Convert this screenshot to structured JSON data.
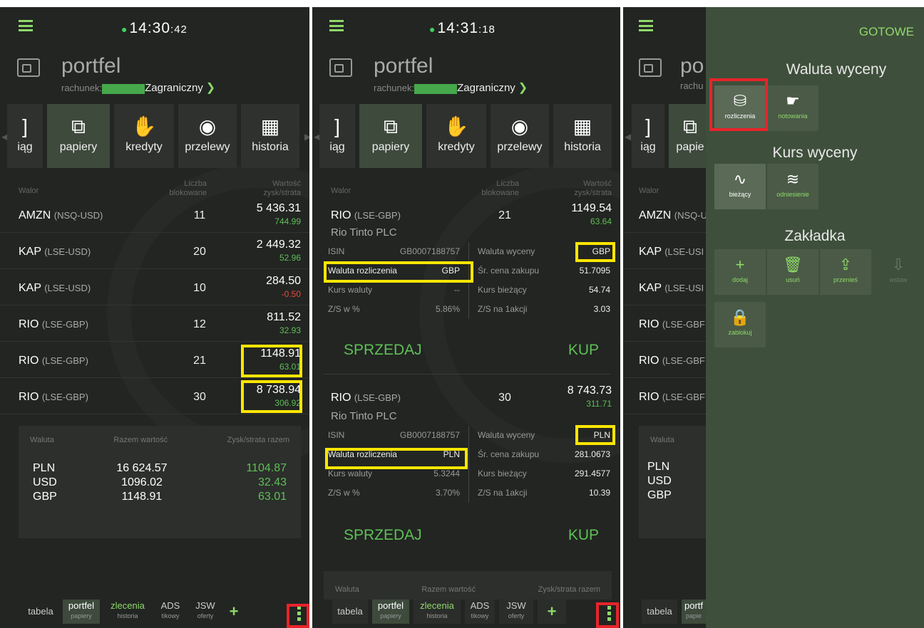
{
  "screen1": {
    "clock_main": "14:30",
    "clock_sec": ":42",
    "title": "portfel",
    "account_label": "rachunek:",
    "account_name": "Zagraniczny",
    "tabs": [
      "iąg",
      "papiery",
      "kredyty",
      "przelewy",
      "historia"
    ],
    "header": {
      "walor": "Walor",
      "liczba": "Liczba",
      "blokowane": "blokowane",
      "wartosc": "Wartość",
      "zysk": "zysk/strata"
    },
    "rows": [
      {
        "sym": "AMZN",
        "mkt": "(NSQ-USD)",
        "qty": "11",
        "value": "5 436.31",
        "pl": "744.99"
      },
      {
        "sym": "KAP",
        "mkt": "(LSE-USD)",
        "qty": "20",
        "value": "2 449.32",
        "pl": "52.96"
      },
      {
        "sym": "KAP",
        "mkt": "(LSE-USD)",
        "qty": "10",
        "value": "284.50",
        "pl": "-0.50"
      },
      {
        "sym": "RIO",
        "mkt": "(LSE-GBP)",
        "qty": "12",
        "value": "811.52",
        "pl": "32.93"
      },
      {
        "sym": "RIO",
        "mkt": "(LSE-GBP)",
        "qty": "21",
        "value": "1148.91",
        "pl": "63.01"
      },
      {
        "sym": "RIO",
        "mkt": "(LSE-GBP)",
        "qty": "30",
        "value": "8 738.94",
        "pl": "306.92"
      }
    ],
    "summary": {
      "h_waluta": "Waluta",
      "h_razem": "Razem wartość",
      "h_zysk": "Zysk/strata razem",
      "rows": [
        {
          "cur": "PLN",
          "total": "16 624.57",
          "pl": "1104.87"
        },
        {
          "cur": "USD",
          "total": "1096.02",
          "pl": "32.43"
        },
        {
          "cur": "GBP",
          "total": "1148.91",
          "pl": "63.01"
        }
      ]
    },
    "bottom": {
      "tabela": "tabela",
      "portfel": "portfel",
      "portfel_sub": "papiery",
      "zlecenia": "zlecenia",
      "zlecenia_sub": "historia",
      "ads": "ADS",
      "ads_sub": "tikowy",
      "jsw": "JSW",
      "jsw_sub": "oferty",
      "plus": "+"
    }
  },
  "screen2": {
    "clock_main": "14:31",
    "clock_sec": ":18",
    "title": "portfel",
    "account_label": "rachunek:",
    "account_name": "Zagraniczny",
    "tabs": [
      "iąg",
      "papiery",
      "kredyty",
      "przelewy",
      "historia"
    ],
    "header": {
      "walor": "Walor",
      "liczba": "Liczba",
      "blokowane": "blokowane",
      "wartosc": "Wartość",
      "zysk": "zysk/strata"
    },
    "d1": {
      "sym": "RIO",
      "mkt": "(LSE-GBP)",
      "qty": "21",
      "value": "1149.54",
      "pl": "63.64",
      "name": "Rio Tinto PLC",
      "isin_l": "ISIN",
      "isin": "GB0007188757",
      "wyc_l": "Waluta wyceny",
      "wyc": "GBP",
      "roz_l": "Waluta rozliczenia",
      "roz": "GBP",
      "sr_l": "Śr. cena zakupu",
      "sr": "51.7095",
      "kw_l": "Kurs waluty",
      "kw": "--",
      "kb_l": "Kurs bieżący",
      "kb": "54.74",
      "zs_l": "Z/S w %",
      "zs": "5.86%",
      "za_l": "Z/S na 1akcji",
      "za": "3.03"
    },
    "d2": {
      "sym": "RIO",
      "mkt": "(LSE-GBP)",
      "qty": "30",
      "value": "8 743.73",
      "pl": "311.71",
      "name": "Rio Tinto PLC",
      "isin_l": "ISIN",
      "isin": "GB0007188757",
      "wyc_l": "Waluta wyceny",
      "wyc": "PLN",
      "roz_l": "Waluta rozliczenia",
      "roz": "PLN",
      "sr_l": "Śr. cena zakupu",
      "sr": "281.0673",
      "kw_l": "Kurs waluty",
      "kw": "5.3244",
      "kb_l": "Kurs bieżący",
      "kb": "291.4577",
      "zs_l": "Z/S w %",
      "zs": "3.70%",
      "za_l": "Z/S na 1akcji",
      "za": "10.39"
    },
    "sell": "SPRZEDAJ",
    "buy": "KUP",
    "summary": {
      "h_waluta": "Waluta",
      "h_razem": "Razem wartość",
      "h_zysk": "Zysk/strata razem"
    },
    "bottom": {
      "tabela": "tabela",
      "portfel": "portfel",
      "portfel_sub": "papiery",
      "zlecenia": "zlecenia",
      "zlecenia_sub": "historia",
      "ads": "ADS",
      "ads_sub": "tikowy",
      "jsw": "JSW",
      "jsw_sub": "oferty",
      "plus": "+"
    }
  },
  "screen3": {
    "title_partial": "po",
    "account_partial": "rachu",
    "tabs": [
      "iąg",
      "papie"
    ],
    "header_walor": "Walor",
    "rows": [
      {
        "sym": "AMZN",
        "mkt": "(NSQ-U"
      },
      {
        "sym": "KAP",
        "mkt": "(LSE-USI"
      },
      {
        "sym": "KAP",
        "mkt": "(LSE-USI"
      },
      {
        "sym": "RIO",
        "mkt": "(LSE-GBF"
      },
      {
        "sym": "RIO",
        "mkt": "(LSE-GBF"
      },
      {
        "sym": "RIO",
        "mkt": "(LSE-GBF"
      }
    ],
    "summary_waluta": "Waluta",
    "summary_curs": [
      "PLN",
      "USD",
      "GBP"
    ],
    "bottom_tabela": "tabela",
    "bottom_portfel": "portf",
    "bottom_portfel_sub": "papie",
    "menu": {
      "done": "GOTOWE",
      "waluta_head": "Waluta wyceny",
      "rozliczenia": "rozliczenia",
      "notowania": "notowania",
      "kurs_head": "Kurs wyceny",
      "biezacy": "bieżący",
      "odniesienie": "odniesienie",
      "zakladka_head": "Zakładka",
      "dodaj": "dodaj",
      "usun": "usuń",
      "przenies": "przenieś",
      "wstaw": "wstaw",
      "zablokuj": "zablokuj"
    }
  },
  "colors": {
    "accent": "#8fd96a",
    "profit": "#5fbf56",
    "loss": "#e84a3a",
    "highlight": "#ffe600",
    "alert": "#e8232a"
  }
}
